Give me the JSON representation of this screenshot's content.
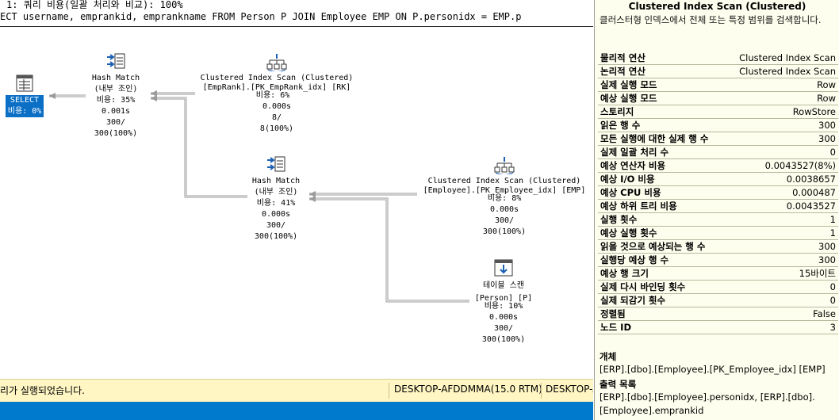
{
  "plan": {
    "query_line1": "1: 쿼리 비용(일괄 처리와 비교): 100%",
    "query_line2": "ECT username, emprankid, emprankname FROM Person P JOIN Employee EMP ON P.personidx = EMP.p",
    "nodes": {
      "select": {
        "label": "SELECT",
        "cost": "비용: 0%"
      },
      "hash1": {
        "name": "Hash Match",
        "sub": "(내부 조인)",
        "cost": "비용: 35%",
        "time": "0.001s",
        "rows": "300/",
        "pct": "300(100%)"
      },
      "cis_rank": {
        "name": "Clustered Index Scan (Clustered)",
        "obj": "[EmpRank].[PK_EmpRank_idx] [RK]",
        "cost": "비용: 6%",
        "time": "0.000s",
        "rows": "8/",
        "pct": "8(100%)"
      },
      "hash2": {
        "name": "Hash Match",
        "sub": "(내부 조인)",
        "cost": "비용: 41%",
        "time": "0.000s",
        "rows": "300/",
        "pct": "300(100%)"
      },
      "cis_emp": {
        "name": "Clustered Index Scan (Clustered)",
        "obj": "[Employee].[PK_Employee_idx] [EMP]",
        "cost": "비용: 8%",
        "time": "0.000s",
        "rows": "300/",
        "pct": "300(100%)"
      },
      "tscan": {
        "name": "테이블 스캔",
        "obj": "[Person] [P]",
        "cost": "비용: 10%",
        "time": "0.000s",
        "rows": "300/",
        "pct": "300(100%)"
      }
    }
  },
  "status": {
    "message": "리가 실행되었습니다.",
    "server1": "DESKTOP-AFDDMMA(15.0 RTM)",
    "server2": "DESKTOP-A"
  },
  "properties": {
    "title": "Clustered Index Scan (Clustered)",
    "description": "클러스터형 인덱스에서 전체 또는 특정 범위를 검색합니다.",
    "rows": [
      {
        "key": "물리적 연산",
        "value": "Clustered Index Scan"
      },
      {
        "key": "논리적 연산",
        "value": "Clustered Index Scan"
      },
      {
        "key": "실제 실행 모드",
        "value": "Row"
      },
      {
        "key": "예상 실행 모드",
        "value": "Row"
      },
      {
        "key": "스토리지",
        "value": "RowStore"
      },
      {
        "key": "읽은 행 수",
        "value": "300"
      },
      {
        "key": "모든 실행에 대한 실제 행 수",
        "value": "300"
      },
      {
        "key": "실제 일괄 처리 수",
        "value": "0"
      },
      {
        "key": "예상 연산자 비용",
        "value": "0.0043527(8%)"
      },
      {
        "key": "예상 I/O 비용",
        "value": "0.0038657"
      },
      {
        "key": "예상 CPU 비용",
        "value": "0.000487"
      },
      {
        "key": "예상 하위 트리 비용",
        "value": "0.0043527"
      },
      {
        "key": "실행 횟수",
        "value": "1"
      },
      {
        "key": "예상 실행 횟수",
        "value": "1"
      },
      {
        "key": "읽을 것으로 예상되는 행 수",
        "value": "300"
      },
      {
        "key": "실행당 예상 행 수",
        "value": "300"
      },
      {
        "key": "예상 행 크기",
        "value": "15바이트"
      },
      {
        "key": "실제 다시 바인딩 횟수",
        "value": "0"
      },
      {
        "key": "실제 되감기 횟수",
        "value": "0"
      },
      {
        "key": "정렬됨",
        "value": "False"
      },
      {
        "key": "노드 ID",
        "value": "3"
      }
    ],
    "object_label": "개체",
    "object_value": "[ERP].[dbo].[Employee].[PK_Employee_idx] [EMP]",
    "output_label": "출력 목록",
    "output_value": "[ERP].[dbo].[Employee].personidx, [ERP].[dbo].[Employee].emprankid"
  },
  "colors": {
    "accent": "#007acc",
    "status_bg": "#fff6c3",
    "props_bg": "#fefeee",
    "selected": "#0b6fc6"
  }
}
